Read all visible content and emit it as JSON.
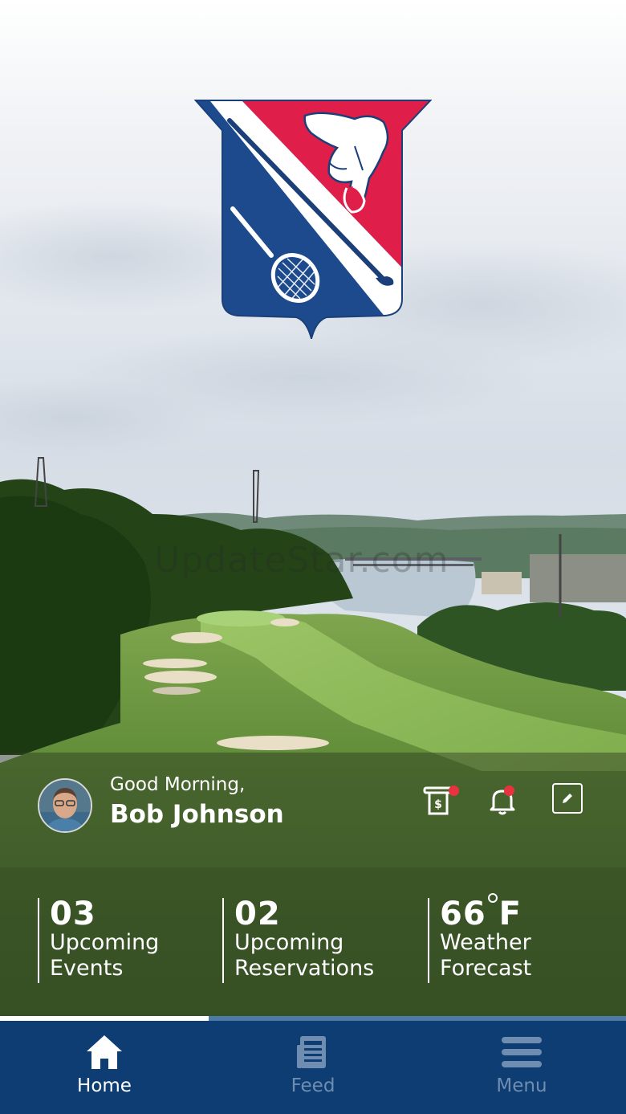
{
  "brand": {
    "crest_icon": "club-crest-saddle-golf-club-racquet",
    "colors": {
      "red": "#e01e4a",
      "blue": "#1d4a8c",
      "navy": "#0d3d73"
    }
  },
  "watermark": "UpdateStar.com",
  "user": {
    "greeting": "Good Morning,",
    "name": "Bob Johnson",
    "avatar_icon": "user-avatar-photo"
  },
  "header_icons": [
    {
      "name": "statement-icon",
      "has_badge": true
    },
    {
      "name": "bell-icon",
      "has_badge": true
    },
    {
      "name": "edit-icon",
      "has_badge": false
    }
  ],
  "stats": {
    "events": {
      "value": "03",
      "line1": "Upcoming",
      "line2": "Events"
    },
    "reservations": {
      "value": "02",
      "line1": "Upcoming",
      "line2": "Reservations"
    },
    "weather": {
      "value": "66",
      "unit": "F",
      "line1": "Weather",
      "line2": "Forecast"
    }
  },
  "nav": {
    "active_index": 0,
    "items": [
      {
        "label": "Home",
        "icon": "home-icon"
      },
      {
        "label": "Feed",
        "icon": "feed-icon"
      },
      {
        "label": "Menu",
        "icon": "menu-icon"
      }
    ]
  }
}
